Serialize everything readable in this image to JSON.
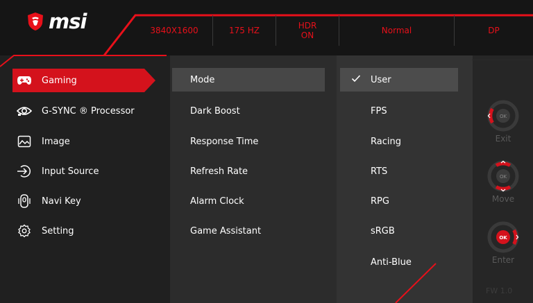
{
  "header": {
    "brand": "msi",
    "resolution": "3840X1600",
    "refresh": "175 HZ",
    "hdr_line1": "HDR",
    "hdr_line2": "ON",
    "mode": "Normal",
    "input": "DP"
  },
  "menu": [
    {
      "label": "Gaming",
      "icon": "gamepad-icon",
      "active": true
    },
    {
      "label": "G-SYNC ® Processor",
      "icon": "gsync-eye-icon"
    },
    {
      "label": "Image",
      "icon": "image-icon"
    },
    {
      "label": "Input Source",
      "icon": "input-source-icon"
    },
    {
      "label": "Navi Key",
      "icon": "navi-key-icon"
    },
    {
      "label": "Setting",
      "icon": "gear-icon"
    }
  ],
  "submenu": [
    {
      "label": "Mode",
      "active": true
    },
    {
      "label": "Dark Boost"
    },
    {
      "label": "Response Time"
    },
    {
      "label": "Refresh Rate"
    },
    {
      "label": "Alarm Clock"
    },
    {
      "label": "Game Assistant"
    }
  ],
  "options": [
    {
      "label": "User",
      "selected": true
    },
    {
      "label": "FPS"
    },
    {
      "label": "Racing"
    },
    {
      "label": "RTS"
    },
    {
      "label": "RPG"
    },
    {
      "label": "sRGB"
    },
    {
      "label": "Anti-Blue"
    }
  ],
  "nav": {
    "exit_label": "Exit",
    "move_label": "Move",
    "enter_label": "Enter",
    "ok_text": "OK",
    "firmware": "FW 1.0"
  },
  "colors": {
    "accent": "#e8101a",
    "active_menu": "#d4121c"
  }
}
